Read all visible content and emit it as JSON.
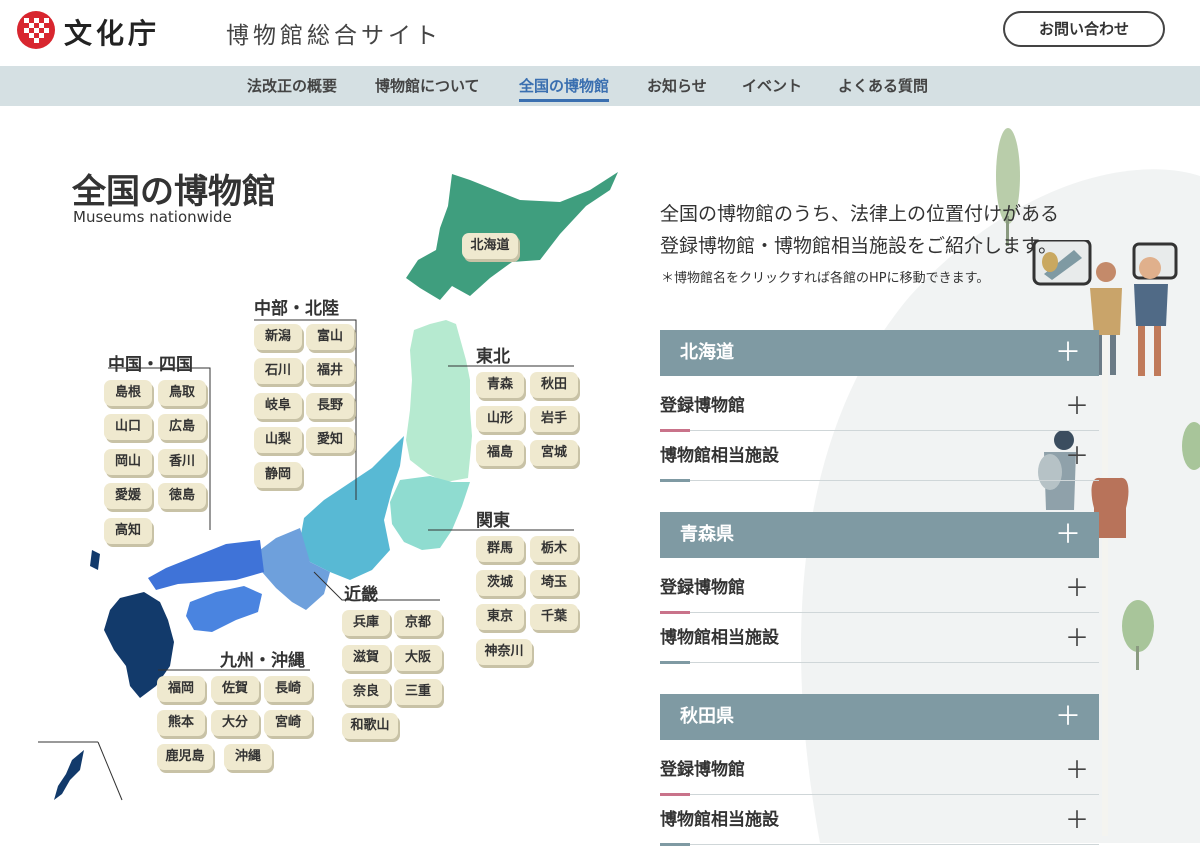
{
  "header": {
    "logo_text": "文化庁",
    "site_title": "博物館総合サイト",
    "contact_label": "お問い合わせ"
  },
  "nav": {
    "items": [
      "法改正の概要",
      "博物館について",
      "全国の博物館",
      "お知らせ",
      "イベント",
      "よくある質問"
    ],
    "active": "全国の博物館"
  },
  "page": {
    "title": "全国の博物館",
    "subtitle": "Museums nationwide",
    "lead_line1": "全国の博物館のうち、法律上の位置付けがある",
    "lead_line2": "登録博物館・博物館相当施設をご紹介します。",
    "note": "＊博物館名をクリックすれば各館のHPに移動できます。"
  },
  "regions": {
    "hokkaido": {
      "label": "北海道"
    },
    "tohoku": {
      "title": "東北",
      "prefs": [
        "青森",
        "秋田",
        "山形",
        "岩手",
        "福島",
        "宮城"
      ]
    },
    "kanto": {
      "title": "関東",
      "prefs": [
        "群馬",
        "栃木",
        "茨城",
        "埼玉",
        "東京",
        "千葉",
        "神奈川"
      ]
    },
    "chubu": {
      "title": "中部・北陸",
      "prefs": [
        "新潟",
        "富山",
        "石川",
        "福井",
        "岐阜",
        "長野",
        "山梨",
        "愛知",
        "静岡"
      ]
    },
    "kinki": {
      "title": "近畿",
      "prefs": [
        "兵庫",
        "京都",
        "滋賀",
        "大阪",
        "奈良",
        "三重",
        "和歌山"
      ]
    },
    "chugoku": {
      "title": "中国・四国",
      "prefs": [
        "島根",
        "鳥取",
        "山口",
        "広島",
        "岡山",
        "香川",
        "愛媛",
        "徳島",
        "高知"
      ]
    },
    "kyushu": {
      "title": "九州・沖縄",
      "prefs": [
        "福岡",
        "佐賀",
        "長崎",
        "熊本",
        "大分",
        "宮崎",
        "鹿児島",
        "沖縄"
      ]
    }
  },
  "accordion": [
    {
      "title": "北海道",
      "rows": [
        "登録博物館",
        "博物館相当施設"
      ]
    },
    {
      "title": "青森県",
      "rows": [
        "登録博物館",
        "博物館相当施設"
      ]
    },
    {
      "title": "秋田県",
      "rows": [
        "登録博物館",
        "博物館相当施設"
      ]
    }
  ],
  "colors": {
    "accent": "#3a6fb0",
    "nav_bg": "#d5e0e3",
    "accordion_head": "#7f9aa3",
    "registered_mark": "#c9738a",
    "equivalent_mark": "#7f9aa3",
    "hokkaido": "#3f9e7e",
    "tohoku": "#b6ead0",
    "kanto": "#8fdcd0",
    "chubu": "#58b9d4",
    "kinki": "#6ea0dc",
    "chugoku_shikoku": "#3f73d8",
    "kyushu": "#123a6b"
  },
  "icons": {
    "plus": "plus-icon"
  }
}
